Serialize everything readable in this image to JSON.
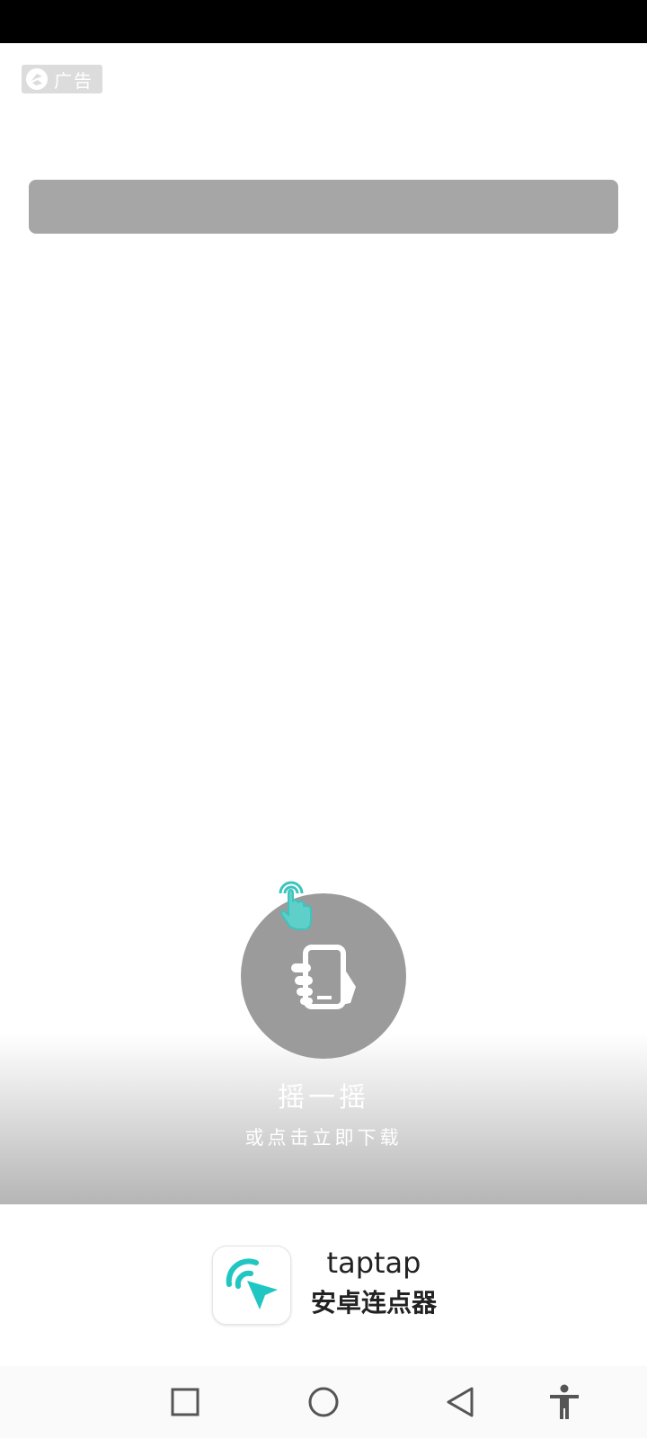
{
  "ad": {
    "label": "广告",
    "icon": "ad-logo-icon"
  },
  "shake": {
    "title": "摇一摇",
    "subtitle": "或点击立即下载",
    "icon": "hand-phone-icon",
    "hint_icon": "tap-finger-icon"
  },
  "app": {
    "name_en": "taptap",
    "name_cn": "安卓连点器",
    "icon": "taptap-cursor-icon",
    "accent": "#1fc6c2"
  },
  "nav": {
    "recent_icon": "square-icon",
    "home_icon": "circle-icon",
    "back_icon": "triangle-back-icon",
    "accessibility_icon": "accessibility-icon"
  }
}
